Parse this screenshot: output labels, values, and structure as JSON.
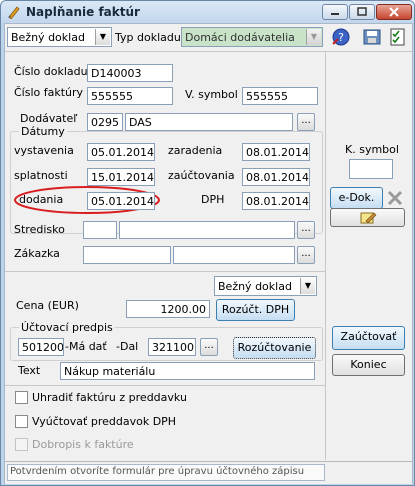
{
  "window": {
    "title": "Naplňanie faktúr"
  },
  "toolbar": {
    "doc_type_value": "Bežný doklad",
    "doc_type_label": "Typ dokladu",
    "supplier_type_value": "Domáci dodávatelia"
  },
  "form": {
    "cislo_dokladu_label": "Číslo dokladu",
    "cislo_dokladu_value": "D140003",
    "cislo_faktury_label": "Číslo faktúry",
    "cislo_faktury_value": "555555",
    "v_symbol_label": "V. symbol",
    "v_symbol_value": "555555",
    "dodavatel_label": "Dodávateľ",
    "dodavatel_code": "0295",
    "dodavatel_name": "DAS",
    "datumy_label": "Dátumy",
    "vystavenia_label": "vystavenia",
    "vystavenia_value": "05.01.2014",
    "zaradenia_label": "zaradenia",
    "zaradenia_value": "08.01.2014",
    "splatnosti_label": "splatnosti",
    "splatnosti_value": "15.01.2014",
    "zauctovania_label": "zaúčtovania",
    "zauctovania_value": "08.01.2014",
    "dodania_label": "dodania",
    "dodania_value": "05.01.2014",
    "dph_label": "DPH",
    "dph_value": "08.01.2014",
    "stredisko_label": "Stredisko",
    "zakazka_label": "Zákazka",
    "doc_type2_value": "Bežný doklad",
    "cena_label": "Cena (EUR)",
    "cena_value": "1200.00",
    "rozuct_dph_label": "Rozúčt. DPH",
    "uctovaci_predpis_label": "Účtovací predpis",
    "ma_dat_account": "501200",
    "ma_dat_label": "-Má dať",
    "dal_label": "-Dal",
    "dal_account": "321100",
    "rozuctovanie_label": "Rozúčtovanie",
    "text_label": "Text",
    "text_value": "Nákup materiálu",
    "check1_label": "Uhradiť faktúru z preddavku",
    "check2_label": "Vyúčtovať preddavok DPH",
    "check3_label": "Dobropis k faktúre"
  },
  "side": {
    "k_symbol_label": "K. symbol",
    "k_symbol_value": "",
    "edok_label": "e-Dok.",
    "zauctovat_label": "Zaúčtovať",
    "koniec_label": "Koniec"
  },
  "status": {
    "text": "Potvrdením otvoríte formulár pre úpravu účtovného zápisu"
  },
  "colors": {
    "title_bar": "#c2d6ec",
    "highlight_ring": "#d81e1e",
    "supplier_combo_bg": "#c8e3c8",
    "form_bg": "#f0f0f0"
  },
  "icons": [
    "pen-icon",
    "minimize-icon",
    "maximize-icon",
    "close-icon",
    "help-icon",
    "save-icon",
    "checklist-icon",
    "pencil-note-icon",
    "x-icon",
    "chevron-down-icon"
  ]
}
